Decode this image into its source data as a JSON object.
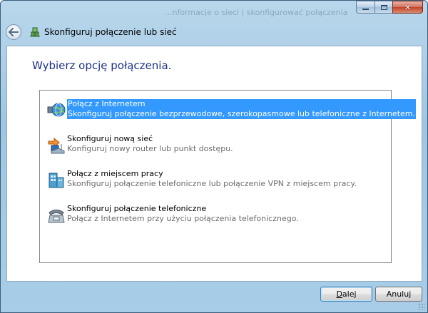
{
  "window": {
    "background_glass_text": "...nformacje o sieci | skonfigurować połączenia",
    "title": "Skonfiguruj połączenie lub sieć",
    "close_glyph": "✕"
  },
  "heading": "Wybierz opcję połączenia.",
  "options": [
    {
      "title": "Połącz z Internetem",
      "desc": "Skonfiguruj połączenie bezprzewodowe, szerokopasmowe lub telefoniczne z Internetem.",
      "icon": "globe-network-icon",
      "selected": true
    },
    {
      "title": "Skonfiguruj nową sieć",
      "desc": "Konfiguruj nowy router lub punkt dostępu.",
      "icon": "router-icon",
      "selected": false
    },
    {
      "title": "Połącz z miejscem pracy",
      "desc": "Skonfiguruj połączenie telefoniczne lub połączenie VPN z miejscem pracy.",
      "icon": "workplace-building-icon",
      "selected": false
    },
    {
      "title": "Skonfiguruj połączenie telefoniczne",
      "desc": "Połącz z Internetem przy użyciu połączenia telefonicznego.",
      "icon": "telephone-icon",
      "selected": false
    }
  ],
  "buttons": {
    "next_mnemonic": "D",
    "next_rest": "alej",
    "cancel": "Anuluj"
  },
  "colors": {
    "heading": "#1e3287",
    "selection": "#3399ff",
    "description_text": "#6d6d6d"
  }
}
